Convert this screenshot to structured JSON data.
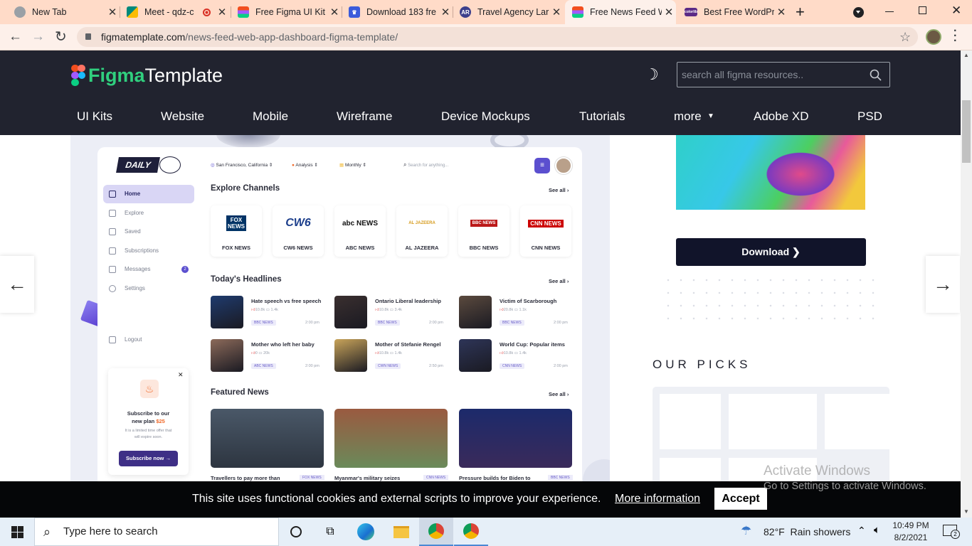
{
  "browser": {
    "tabs": [
      {
        "title": "New Tab",
        "icon": "chrome-icon",
        "color": "#5f6368"
      },
      {
        "title": "Meet - qdz-c",
        "icon": "meet-icon",
        "color": "#00897b"
      },
      {
        "title": "Free Figma UI Kit",
        "icon": "figma-icon",
        "color": "#a259ff"
      },
      {
        "title": "Download 183 fre",
        "icon": "crown-icon",
        "color": "#3b5bdb"
      },
      {
        "title": "Travel Agency Lar",
        "icon": "ar-icon",
        "color": "#3c3f8c",
        "badge": "AR"
      },
      {
        "title": "Free News Feed W",
        "icon": "figma-icon",
        "color": "#a259ff"
      },
      {
        "title": "Best Free WordPr",
        "icon": "colorlib-icon",
        "color": "#5b2a86"
      }
    ],
    "new_tab": "+",
    "url_domain": "figmatemplate.com",
    "url_path": "/news-feed-web-app-dashboard-figma-template/"
  },
  "site": {
    "logo_part1": "Figma",
    "logo_part2": "Template",
    "search_placeholder": "search all figma resources..",
    "nav": [
      "UI Kits",
      "Website",
      "Mobile",
      "Wireframe",
      "Device Mockups",
      "Tutorials",
      "more",
      "Adobe XD",
      "PSD"
    ]
  },
  "dashboard": {
    "brand": "DAILY",
    "location": "San Francisco, California",
    "analysis": "Analysis",
    "period": "Monthly",
    "search_placeholder": "Search for anything...",
    "sidebar": [
      "Home",
      "Explore",
      "Saved",
      "Subscriptions",
      "Messages",
      "Settings"
    ],
    "messages_count": "2",
    "logout": "Logout",
    "promo_title_1": "Subscribe to our",
    "promo_title_2": "new plan",
    "promo_price": "$25",
    "promo_text_1": "It is a limited time offer that",
    "promo_text_2": "will expire soon.",
    "promo_button": "Subscribe now",
    "explore_heading": "Explore Channels",
    "see_all": "See all",
    "channels": [
      {
        "name": "FOX NEWS",
        "logo": "FOX NEWS",
        "color": "#003366"
      },
      {
        "name": "CW6 NEWS",
        "logo": "CW6",
        "color": "#1d3f8c"
      },
      {
        "name": "ABC NEWS",
        "logo": "abc NEWS",
        "color": "#111111"
      },
      {
        "name": "AL JAZEERA",
        "logo": "AL JAZEERA",
        "color": "#d69b1c"
      },
      {
        "name": "BBC NEWS",
        "logo": "BBC NEWS",
        "color": "#bb1919"
      },
      {
        "name": "CNN NEWS",
        "logo": "CNN NEWS",
        "color": "#cc0000"
      }
    ],
    "headlines_heading": "Today's Headlines",
    "headlines": [
      {
        "title": "Hate speech vs free speech",
        "likes": "10.8k",
        "comments": "1.4k",
        "source": "BBC NEWS",
        "time": "2:00 pm",
        "color": "#1f3b6e"
      },
      {
        "title": "Ontario Liberal leadership",
        "likes": "10.8k",
        "comments": "3.4k",
        "source": "BBC NEWS",
        "time": "2:00 pm",
        "color": "#3a2f2f"
      },
      {
        "title": "Victim of Scarborough",
        "likes": "20.8k",
        "comments": "1.1k",
        "source": "BBC NEWS",
        "time": "2:00 pm",
        "color": "#5b4a3e"
      },
      {
        "title": "Mother who left her baby",
        "likes": "0",
        "comments": "20k",
        "source": "ABC NEWS",
        "time": "2:00 pm",
        "color": "#8c6a5a"
      },
      {
        "title": "Mother of Stefanie Rengel",
        "likes": "10.8k",
        "comments": "1.4k",
        "source": "CWN NEWS",
        "time": "2:50 pm",
        "color": "#c9a45a"
      },
      {
        "title": "World Cup: Popular items",
        "likes": "10.8k",
        "comments": "1.4k",
        "source": "CNN NEWS",
        "time": "2:00 pm",
        "color": "#2e3558"
      }
    ],
    "featured_heading": "Featured News",
    "featured": [
      {
        "title": "Travellers to pay more than",
        "source": "FOX NEWS",
        "color": "#3d4a5a"
      },
      {
        "title": "Myanmar's military seizes",
        "source": "CNN NEWS",
        "color": "#8a4a3a"
      },
      {
        "title": "Pressure builds for Biden to",
        "source": "BBC NEWS",
        "color": "#1c2a6b"
      }
    ]
  },
  "sidebar_right": {
    "download": "Download",
    "picks_heading": "OUR PICKS"
  },
  "cookie": {
    "text": "This site uses functional cookies and external scripts to improve your experience.",
    "more": "More information",
    "accept": "Accept"
  },
  "watermark": {
    "line1": "Activate Windows",
    "line2": "Go to Settings to activate Windows."
  },
  "taskbar": {
    "search": "Type here to search",
    "weather": "82°F  Rain showers",
    "time": "10:49 PM",
    "date": "8/2/2021",
    "notif_count": "2"
  }
}
